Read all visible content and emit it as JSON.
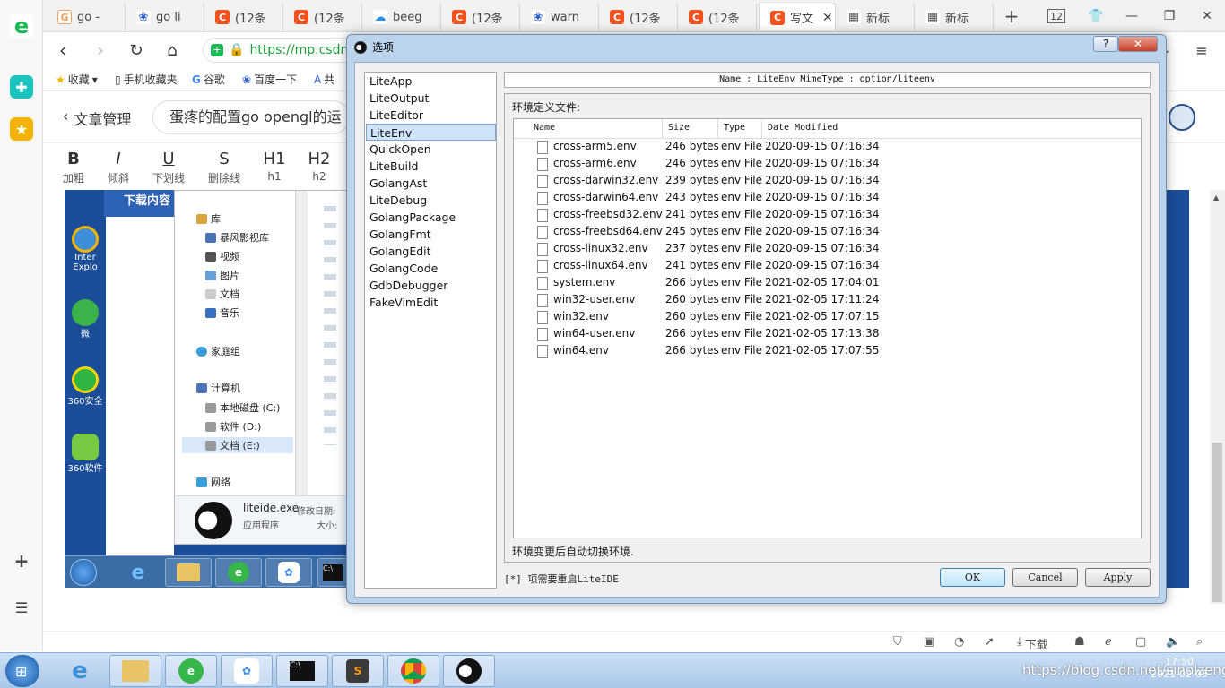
{
  "browser": {
    "tabs": [
      {
        "label": "go -",
        "icon": "go-icon"
      },
      {
        "label": "go li",
        "icon": "paw-icon"
      },
      {
        "label": "(12条",
        "icon": "csdn-icon"
      },
      {
        "label": "(12条",
        "icon": "csdn-icon"
      },
      {
        "label": "beeg",
        "icon": "cloud-icon"
      },
      {
        "label": "(12条",
        "icon": "csdn-icon"
      },
      {
        "label": "warn",
        "icon": "paw-icon"
      },
      {
        "label": "(12条",
        "icon": "csdn-icon"
      },
      {
        "label": "(12条",
        "icon": "csdn-icon"
      },
      {
        "label": "写文",
        "icon": "csdn-icon"
      },
      {
        "label": "新标",
        "icon": "grid-icon"
      },
      {
        "label": "新标",
        "icon": "grid-icon"
      }
    ],
    "tab_count": "12",
    "url": "https://mp.csdn.",
    "bookmarks": [
      "收藏",
      "手机收藏夹",
      "谷歌",
      "百度一下",
      "共"
    ],
    "status_download": "下载"
  },
  "csdn": {
    "back_label": "文章管理",
    "article_title": "蛋疼的配置go opengl的运",
    "toolbar": [
      {
        "glyph": "B",
        "label": "加粗"
      },
      {
        "glyph": "I",
        "label": "倾斜"
      },
      {
        "glyph": "U",
        "label": "下划线"
      },
      {
        "glyph": "S",
        "label": "删除线"
      },
      {
        "glyph": "H1",
        "label": "h1"
      },
      {
        "glyph": "H2",
        "label": "h2"
      }
    ]
  },
  "embedded": {
    "download_tab": "下载内容",
    "desktop_icons": [
      "Inter Explo",
      "微",
      "360安全",
      "360软件"
    ],
    "explorer_items": [
      "库",
      "暴风影视库",
      "视频",
      "图片",
      "文档",
      "音乐",
      "家庭组",
      "计算机",
      "本地磁盘 (C:)",
      "软件 (D:)",
      "文档 (E:)",
      "网络"
    ],
    "file_name": "liteide.exe",
    "file_type": "应用程序",
    "file_modified": "修改日期:",
    "file_size": "大小:"
  },
  "dialog": {
    "title": "选项",
    "help_label": "?",
    "close_label": "✕",
    "pages": [
      "LiteApp",
      "LiteOutput",
      "LiteEditor",
      "LiteEnv",
      "QuickOpen",
      "LiteBuild",
      "GolangAst",
      "LiteDebug",
      "GolangPackage",
      "GolangFmt",
      "GolangEdit",
      "GolangCode",
      "GdbDebugger",
      "FakeVimEdit"
    ],
    "selected_page": "LiteEnv",
    "info_header": "Name : LiteEnv    MimeType : option/liteenv",
    "env_label": "环境定义文件:",
    "columns": [
      "Name",
      "Size",
      "Type",
      "Date Modified"
    ],
    "files": [
      {
        "name": "cross-arm5.env",
        "size": "246 bytes",
        "type": "env File",
        "date": "2020-09-15 07:16:34"
      },
      {
        "name": "cross-arm6.env",
        "size": "246 bytes",
        "type": "env File",
        "date": "2020-09-15 07:16:34"
      },
      {
        "name": "cross-darwin32.env",
        "size": "239 bytes",
        "type": "env File",
        "date": "2020-09-15 07:16:34"
      },
      {
        "name": "cross-darwin64.env",
        "size": "243 bytes",
        "type": "env File",
        "date": "2020-09-15 07:16:34"
      },
      {
        "name": "cross-freebsd32.env",
        "size": "241 bytes",
        "type": "env File",
        "date": "2020-09-15 07:16:34"
      },
      {
        "name": "cross-freebsd64.env",
        "size": "245 bytes",
        "type": "env File",
        "date": "2020-09-15 07:16:34"
      },
      {
        "name": "cross-linux32.env",
        "size": "237 bytes",
        "type": "env File",
        "date": "2020-09-15 07:16:34"
      },
      {
        "name": "cross-linux64.env",
        "size": "241 bytes",
        "type": "env File",
        "date": "2020-09-15 07:16:34"
      },
      {
        "name": "system.env",
        "size": "266 bytes",
        "type": "env File",
        "date": "2021-02-05 17:04:01"
      },
      {
        "name": "win32-user.env",
        "size": "260 bytes",
        "type": "env File",
        "date": "2021-02-05 17:11:24"
      },
      {
        "name": "win32.env",
        "size": "260 bytes",
        "type": "env File",
        "date": "2021-02-05 17:07:15"
      },
      {
        "name": "win64-user.env",
        "size": "266 bytes",
        "type": "env File",
        "date": "2021-02-05 17:13:38"
      },
      {
        "name": "win64.env",
        "size": "266 bytes",
        "type": "env File",
        "date": "2021-02-05 17:07:55"
      }
    ],
    "auto_switch_label": "环境变更后自动切换环境.",
    "restart_note": "[*] 项需要重启LiteIDE",
    "ok_label": "OK",
    "cancel_label": "Cancel",
    "apply_label": "Apply"
  },
  "taskbar": {
    "time": "17:50",
    "date": "2021-02-05",
    "watermark": "https://blog.csdn.net/sinolzeng"
  },
  "colors": {
    "dialog_frame": "#bcd3ec",
    "selection": "#cfe3fb",
    "csdn_red": "#f4511e",
    "url_green": "#1a9e3c"
  }
}
